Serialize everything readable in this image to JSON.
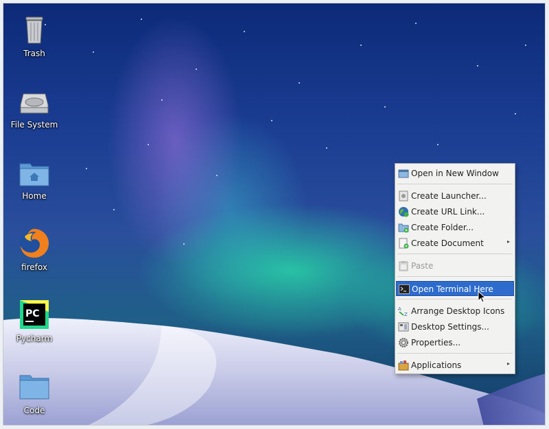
{
  "desktop": {
    "icons": [
      {
        "label": "Trash",
        "icon": "trash-icon"
      },
      {
        "label": "File System",
        "icon": "hard-drive-icon"
      },
      {
        "label": "Home",
        "icon": "home-folder-icon"
      },
      {
        "label": "firefox",
        "icon": "firefox-icon"
      },
      {
        "label": "Pycharm",
        "icon": "pycharm-icon"
      },
      {
        "label": "Code",
        "icon": "folder-icon"
      }
    ],
    "pycharm_logo_text": "PC"
  },
  "context_menu": {
    "items": [
      {
        "label": "Open in New Window",
        "icon": "folder-window-icon"
      },
      {
        "label": "Create Launcher...",
        "icon": "launcher-icon"
      },
      {
        "label": "Create URL Link...",
        "icon": "globe-icon"
      },
      {
        "label": "Create Folder...",
        "icon": "new-folder-icon"
      },
      {
        "label": "Create Document",
        "icon": "new-document-icon",
        "submenu": true
      },
      {
        "label": "Paste",
        "icon": "paste-icon",
        "disabled": true
      },
      {
        "label": "Open Terminal Here",
        "icon": "terminal-icon",
        "highlighted": true
      },
      {
        "label": "Arrange Desktop Icons",
        "icon": "sort-az-icon"
      },
      {
        "label": "Desktop Settings...",
        "icon": "desktop-settings-icon"
      },
      {
        "label": "Properties...",
        "icon": "gear-icon"
      },
      {
        "label": "Applications",
        "icon": "applications-icon",
        "submenu": true
      }
    ],
    "submenu_arrow": "▸"
  },
  "colors": {
    "highlight": "#2d6ccd",
    "menu_bg": "#f2f3f1"
  }
}
